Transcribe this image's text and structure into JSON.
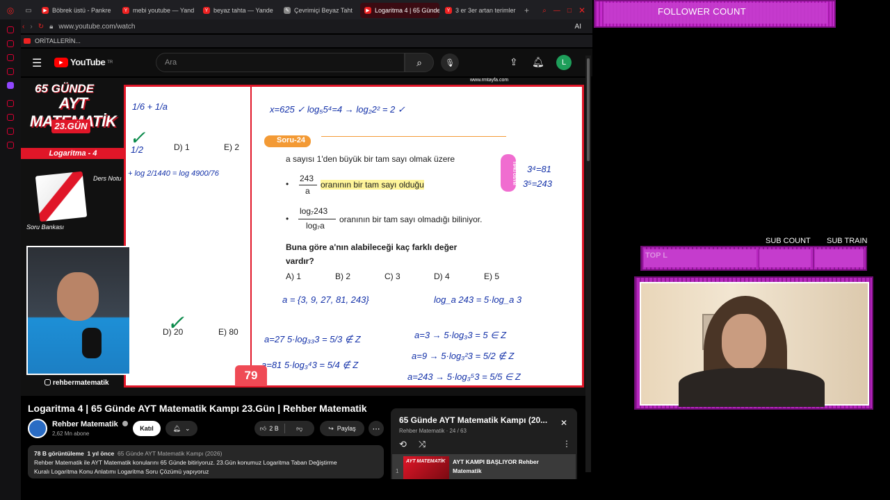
{
  "browser": {
    "tabs": [
      {
        "label": "Böbrek üstü - Pankre",
        "icon": "youtube"
      },
      {
        "label": "mebi youtube — Yand",
        "icon": "yandex"
      },
      {
        "label": "beyaz tahta — Yande",
        "icon": "yandex"
      },
      {
        "label": "Çevrimiçi Beyaz Taht",
        "icon": "whiteboard"
      },
      {
        "label": "Logaritma 4 | 65 Günde A",
        "icon": "youtube",
        "active": true
      },
      {
        "label": "3 er 3er artan terimler",
        "icon": "yandex"
      }
    ],
    "address": "www.youtube.com/watch",
    "bookmark": "ORİTALLERİN...",
    "ai_label": "AI"
  },
  "youtube": {
    "logo": "YouTube",
    "region": "TR",
    "search_placeholder": "Ara",
    "avatar_letter": "L"
  },
  "video_overlay": {
    "brand_days": "65 GÜNDE",
    "brand_title": "AYT MATEMATİK",
    "brand_day": "23.GÜN",
    "topic": "Logaritma - 4",
    "book_note": "Ders Notu",
    "book_bank": "Soru Bankası",
    "instagram": "rehbermatematik",
    "page_number": "79",
    "site": "www.rmtayfa.com"
  },
  "board": {
    "question_label": "Soru-24",
    "line1": "a sayısı 1'den büyük bir tam sayı olmak üzere",
    "frac1_num": "243",
    "frac1_den": "a",
    "bullet1": "oranının bir tam sayı olduğu",
    "frac2_num": "log₇243",
    "frac2_den": "log₇a",
    "bullet2": "oranının bir tam sayı olmadığı biliniyor.",
    "ask": "Buna göre a'nın alabileceği kaç farklı değer vardır?",
    "options": [
      "A) 1",
      "B) 2",
      "C) 3",
      "D) 4",
      "E) 5"
    ],
    "tipki": "TIPKI ÖSYM",
    "left_options_1": [
      "D) 1",
      "E) 2"
    ],
    "left_options_2": [
      "D) 20",
      "E) 80"
    ],
    "hand_notes": {
      "top1": "x=625 ✓   log₅5⁴=4 →   log₂2² = 2 ✓",
      "right1": "3⁴=81",
      "right2": "3⁵=243",
      "set": "a = {3, 9, 27, 81, 243}",
      "log": "log_a 243 = 5·log_a 3",
      "r1": "a=27   5·log₃₃3 = 5/3 ∉ Z",
      "r2": "a=3 → 5·log₃3 = 5 ∈ Z",
      "r3": "a=81   5·log₃⁴3 = 5/4 ∉ Z",
      "r4": "a=9 → 5·log₃²3 = 5/2 ∉ Z",
      "r5": "a=243 → 5·log₃⁵3 = 5/5 ∈ Z",
      "left1": "1/6 + 1/a",
      "left2": "1/2",
      "left3": "+ log 2/1440  =  log 4900/76"
    }
  },
  "video_info": {
    "title": "Logaritma 4 | 65 Günde AYT Matematik Kampı 23.Gün | Rehber Matematik",
    "channel": "Rehber Matematik",
    "subscribers": "2,62 Mn abone",
    "join": "Katıl",
    "likes": "2 B",
    "share": "Paylaş",
    "views": "78 B görüntüleme",
    "age": "1 yıl önce",
    "playlist_ref": "65 Günde AYT Matematik Kampı (2026)",
    "description_1": "Rehber Matematik ile AYT Matematik konularını 65 Günde bitiriyoruz. 23.Gün konumuz Logaritma Taban Değiştirme",
    "description_2": "Kuralı Logaritma Konu Anlatımı Logaritma Soru Çözümü yapıyoruz"
  },
  "playlist": {
    "title": "65 Günde AYT Matematik Kampı (20...",
    "subtitle": "Rehber Matematik · 24 / 63",
    "item_index": "1",
    "item_title": "AYT KAMPI BAŞLIYOR Rehber Matematik",
    "item_thumb": "AYT MATEMATİK"
  },
  "stream": {
    "follower_label": "FOLLOWER COUNT",
    "sub_count_label": "SUB COUNT",
    "sub_train_label": "SUB TRAIN",
    "top_label": "TOP L"
  },
  "colors": {
    "accent_red": "#e01628",
    "stream_purple": "#b626be"
  }
}
